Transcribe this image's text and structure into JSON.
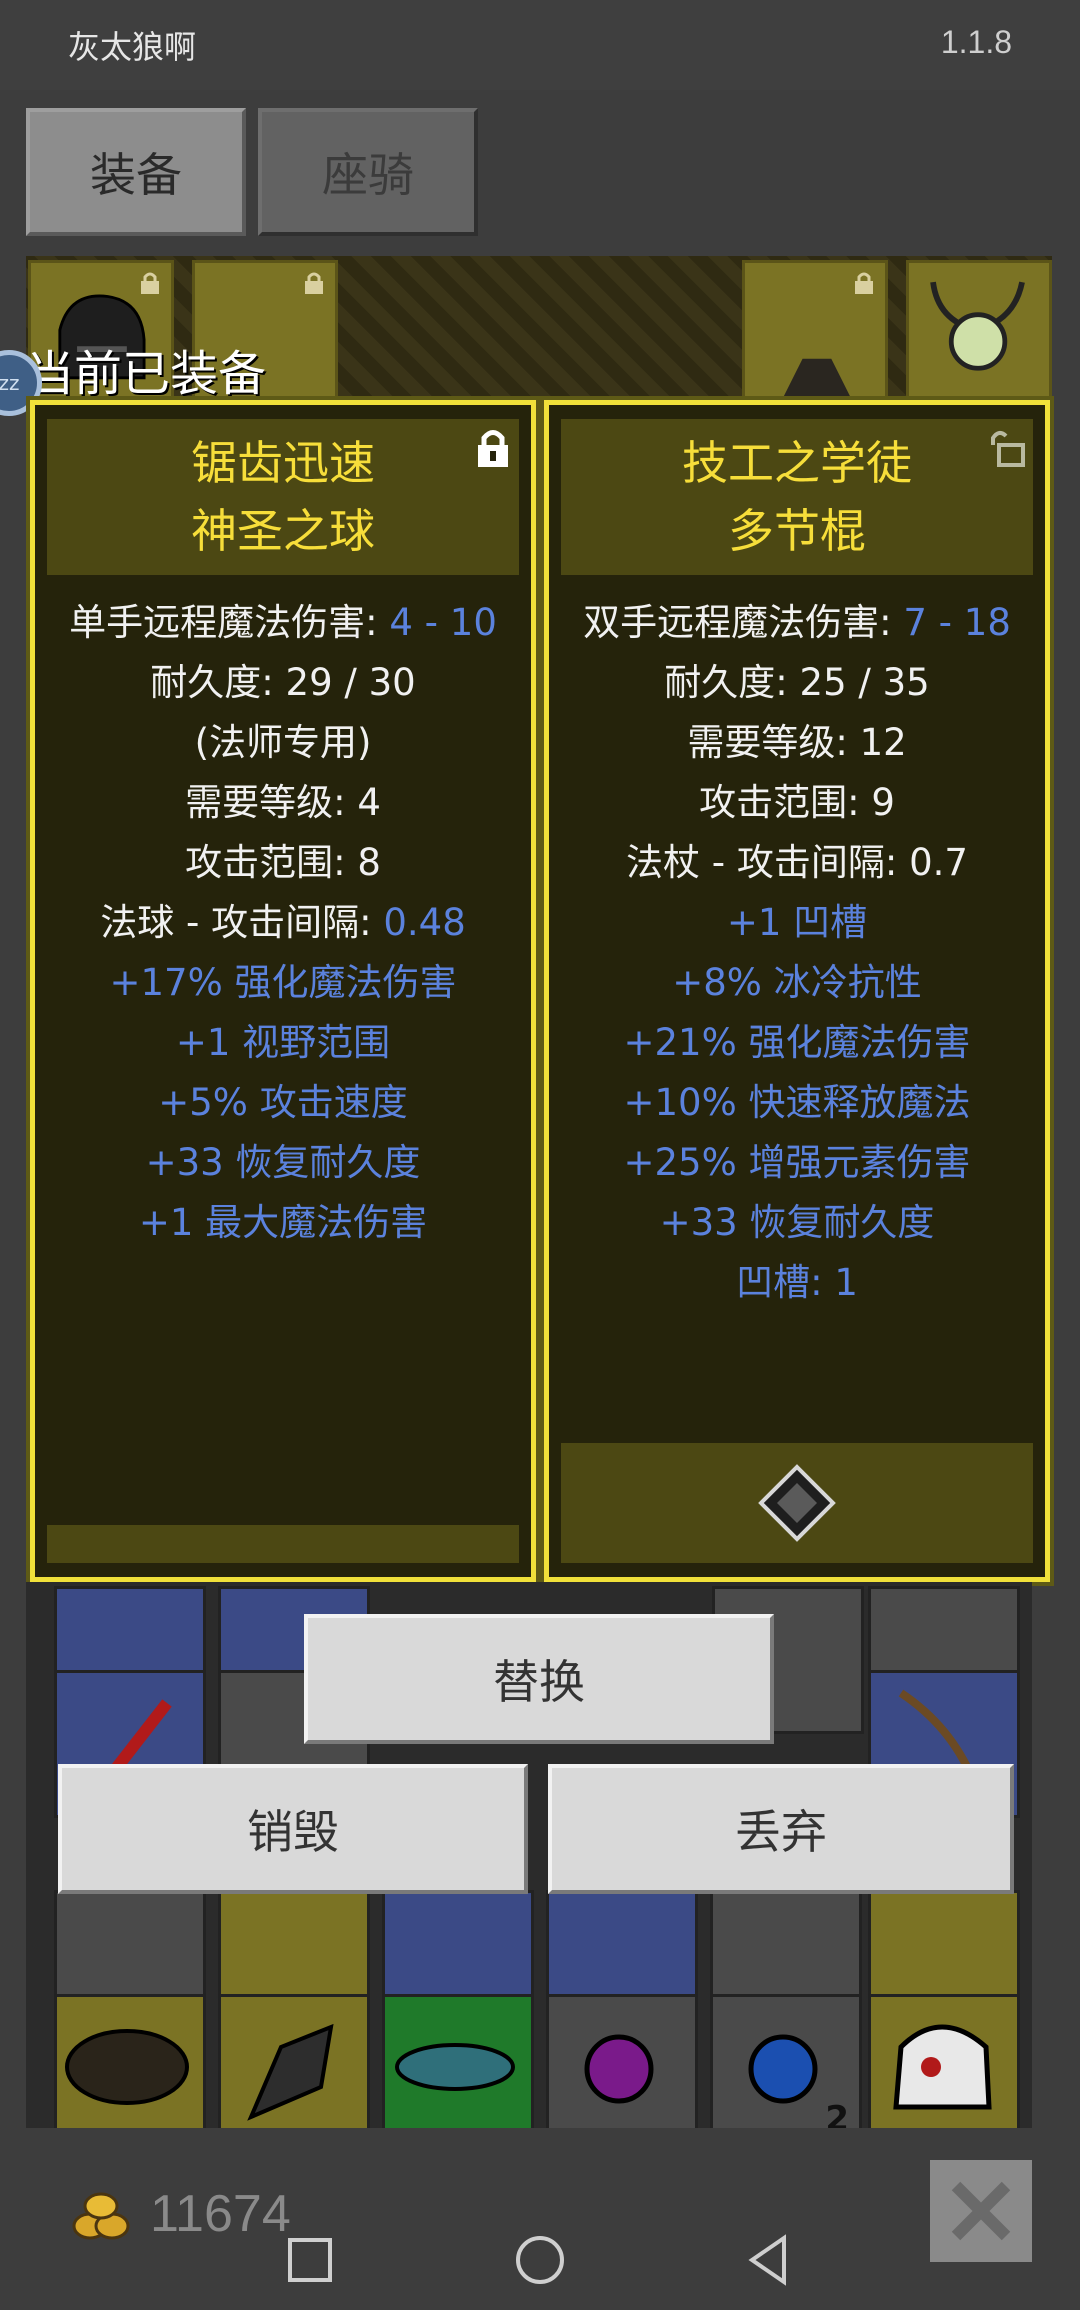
{
  "status": {
    "app_name": "灰太狼啊",
    "version": "1.1.8"
  },
  "tabs": [
    {
      "label": "装备",
      "active": true
    },
    {
      "label": "座骑",
      "active": false
    }
  ],
  "section_label": "当前已装备",
  "sleep_badge": "zz",
  "left_card": {
    "name_line1": "锯齿迅速",
    "name_line2": "神圣之球",
    "lock_state": "locked",
    "stats": [
      {
        "label": "单手远程魔法伤害: ",
        "value": "4 - 10"
      },
      {
        "label": "耐久度: 29 / 30"
      },
      {
        "label": "(法师专用)"
      },
      {
        "label": "需要等级: 4"
      },
      {
        "label": "攻击范围: 8"
      },
      {
        "label": "法球 - 攻击间隔: ",
        "value": "0.48"
      },
      {
        "label": "+17% 强化魔法伤害",
        "blue": true
      },
      {
        "label": "+1 视野范围",
        "blue": true
      },
      {
        "label": "+5% 攻击速度",
        "blue": true
      },
      {
        "label": "+33 恢复耐久度",
        "blue": true
      },
      {
        "label": "+1 最大魔法伤害",
        "blue": true
      }
    ]
  },
  "right_card": {
    "name_line1": "技工之学徒",
    "name_line2": "多节棍",
    "lock_state": "unlocked",
    "socket_icon": "diamond-socket-icon",
    "stats": [
      {
        "label": "双手远程魔法伤害: ",
        "value": "7 - 18"
      },
      {
        "label": "耐久度: 25 / 35"
      },
      {
        "label": "需要等级: 12"
      },
      {
        "label": "攻击范围: 9"
      },
      {
        "label": "法杖 - 攻击间隔: 0.7"
      },
      {
        "label": "+1 凹槽",
        "blue": true
      },
      {
        "label": "+8% 冰冷抗性",
        "blue": true
      },
      {
        "label": "+21% 强化魔法伤害",
        "blue": true
      },
      {
        "label": "+10% 快速释放魔法",
        "blue": true
      },
      {
        "label": "+25% 增强元素伤害",
        "blue": true
      },
      {
        "label": "+33 恢复耐久度",
        "blue": true
      },
      {
        "label": "凹槽: 1",
        "blue": true
      }
    ]
  },
  "buttons": {
    "replace": "替换",
    "destroy": "销毁",
    "discard": "丢弃"
  },
  "inventory": {
    "stack_count": "2"
  },
  "gold": {
    "amount": "11674"
  },
  "colors": {
    "card_border": "#f1e13a",
    "item_name": "#f7de3a",
    "magic_stat": "#5b82dd"
  }
}
